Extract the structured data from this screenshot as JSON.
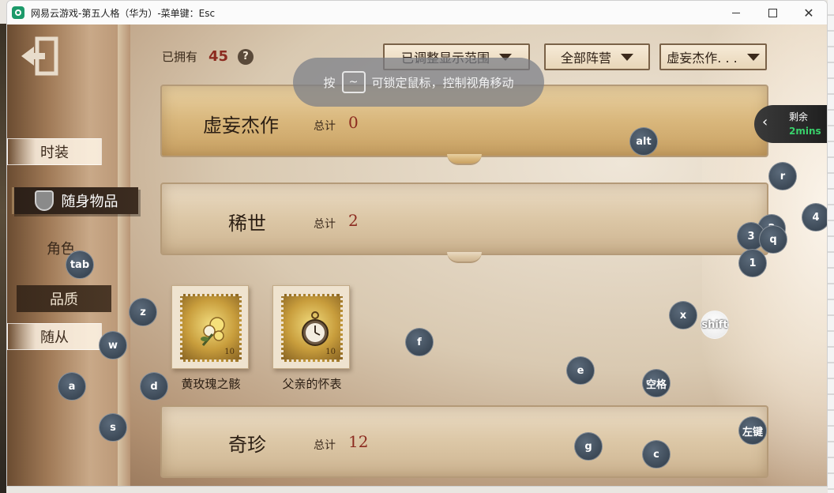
{
  "window": {
    "title": "网易云游戏-第五人格（华为）-菜单键：Esc"
  },
  "sidebar": {
    "items": [
      {
        "label": "时装"
      },
      {
        "label": "随身物品"
      },
      {
        "label": "角色"
      },
      {
        "label": "品质"
      },
      {
        "label": "随从"
      }
    ]
  },
  "header": {
    "owned_label": "已拥有",
    "owned_count": "45",
    "help_symbol": "?",
    "filter_range": "已调整显示范围",
    "filter_faction": "全部阵营",
    "filter_quality": "虚妄杰作. . ."
  },
  "hint": {
    "prefix": "按",
    "key": "~",
    "text": "可锁定鼠标，控制视角移动"
  },
  "categories": [
    {
      "name": "虚妄杰作",
      "total_label": "总计",
      "total": "0"
    },
    {
      "name": "稀世",
      "total_label": "总计",
      "total": "2"
    },
    {
      "name": "奇珍",
      "total_label": "总计",
      "total": "12"
    }
  ],
  "items": [
    {
      "name": "黄玫瑰之骸",
      "stamp_num": "10"
    },
    {
      "name": "父亲的怀表",
      "stamp_num": "10"
    }
  ],
  "timer": {
    "label": "剩余",
    "value": "2mins"
  },
  "key_overlays": [
    "alt",
    "r",
    "4",
    "3",
    "q",
    "1",
    "tab",
    "z",
    "x",
    "shift",
    "w",
    "f",
    "e",
    "空格",
    "a",
    "d",
    "s",
    "左键",
    "g",
    "c",
    "2"
  ]
}
